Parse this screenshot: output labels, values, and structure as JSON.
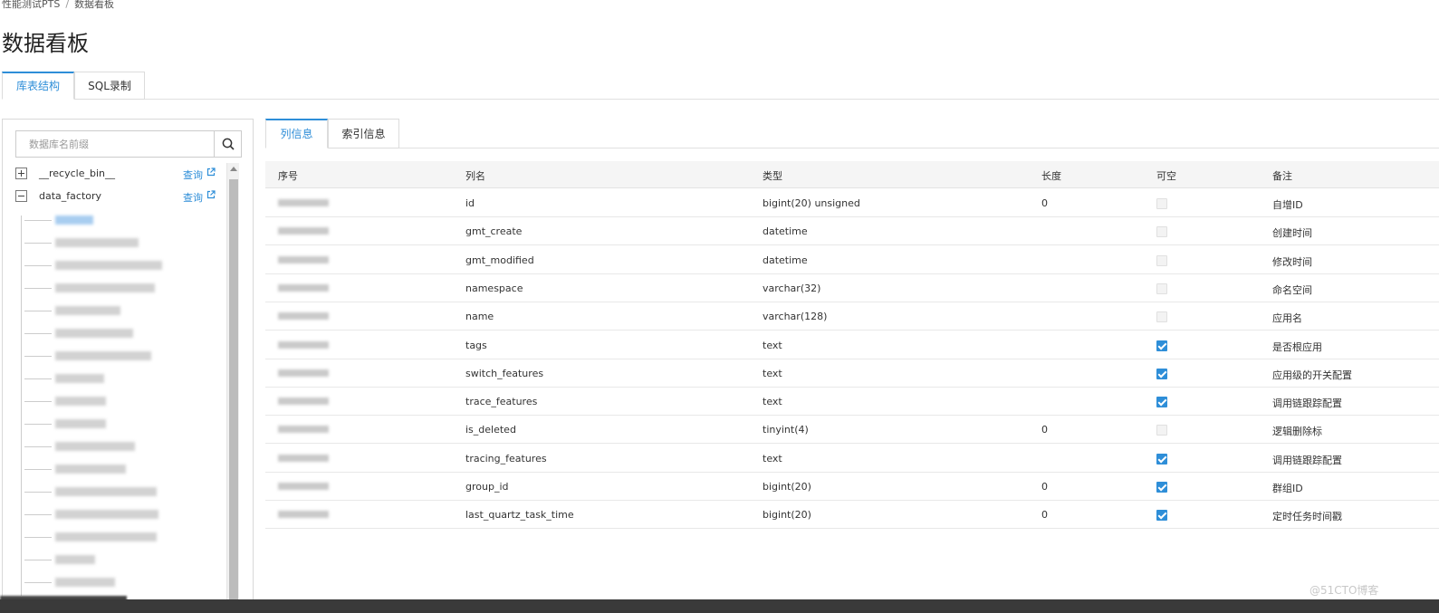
{
  "breadcrumb": {
    "root": "性能测试PTS",
    "separator": "/",
    "current": "数据看板"
  },
  "page_title": "数据看板",
  "top_tabs": [
    {
      "label": "库表结构",
      "active": true
    },
    {
      "label": "SQL录制",
      "active": false
    }
  ],
  "sidebar": {
    "search_placeholder": "数据库名前缀",
    "databases": [
      {
        "name": "__recycle_bin__",
        "query_label": "查询",
        "expanded": false
      },
      {
        "name": "data_factory",
        "query_label": "查询",
        "expanded": true
      }
    ]
  },
  "detail_tabs": [
    {
      "label": "列信息",
      "active": true
    },
    {
      "label": "索引信息",
      "active": false
    }
  ],
  "columns_table": {
    "headers": [
      "序号",
      "列名",
      "类型",
      "长度",
      "可空",
      "备注"
    ],
    "rows": [
      {
        "name": "id",
        "type": "bigint(20) unsigned",
        "length": "0",
        "nullable": false,
        "comment": "自增ID"
      },
      {
        "name": "gmt_create",
        "type": "datetime",
        "length": "",
        "nullable": false,
        "comment": "创建时间"
      },
      {
        "name": "gmt_modified",
        "type": "datetime",
        "length": "",
        "nullable": false,
        "comment": "修改时间"
      },
      {
        "name": "namespace",
        "type": "varchar(32)",
        "length": "",
        "nullable": false,
        "comment": "命名空间"
      },
      {
        "name": "name",
        "type": "varchar(128)",
        "length": "",
        "nullable": false,
        "comment": "应用名"
      },
      {
        "name": "tags",
        "type": "text",
        "length": "",
        "nullable": true,
        "comment": "是否根应用"
      },
      {
        "name": "switch_features",
        "type": "text",
        "length": "",
        "nullable": true,
        "comment": "应用级的开关配置"
      },
      {
        "name": "trace_features",
        "type": "text",
        "length": "",
        "nullable": true,
        "comment": "调用链跟踪配置"
      },
      {
        "name": "is_deleted",
        "type": "tinyint(4)",
        "length": "0",
        "nullable": false,
        "comment": "逻辑删除标"
      },
      {
        "name": "tracing_features",
        "type": "text",
        "length": "",
        "nullable": true,
        "comment": "调用链跟踪配置"
      },
      {
        "name": "group_id",
        "type": "bigint(20)",
        "length": "0",
        "nullable": true,
        "comment": "群组ID"
      },
      {
        "name": "last_quartz_task_time",
        "type": "bigint(20)",
        "length": "0",
        "nullable": true,
        "comment": "定时任务时间戳"
      }
    ]
  },
  "watermark": "@51CTO博客",
  "colors": {
    "accent": "#2e8ed8",
    "border": "#dcdcdc",
    "header_bg": "#f5f5f5"
  },
  "icons": {
    "search": "search-icon",
    "external_link": "external-link-icon",
    "expand": "plus-square-icon",
    "collapse": "minus-square-icon"
  }
}
